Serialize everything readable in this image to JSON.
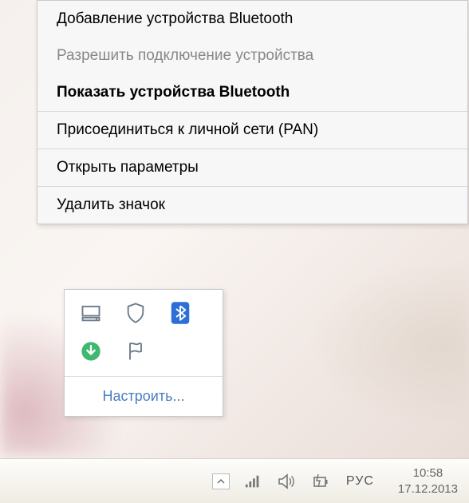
{
  "context_menu": {
    "items": [
      {
        "label": "Добавление устройства Bluetooth",
        "bold": false,
        "disabled": false
      },
      {
        "label": "Разрешить подключение устройства",
        "bold": false,
        "disabled": true
      },
      {
        "label": "Показать устройства Bluetooth",
        "bold": true,
        "disabled": false
      },
      {
        "type": "separator"
      },
      {
        "label": "Присоединиться к личной сети (PAN)",
        "bold": false,
        "disabled": false
      },
      {
        "type": "separator"
      },
      {
        "label": "Открыть параметры",
        "bold": false,
        "disabled": false
      },
      {
        "type": "separator"
      },
      {
        "label": "Удалить значок",
        "bold": false,
        "disabled": false
      }
    ]
  },
  "tray_popup": {
    "icons": [
      "drive-icon",
      "shield-icon",
      "bluetooth-icon",
      "download-icon",
      "flag-icon"
    ],
    "customize_label": "Настроить..."
  },
  "taskbar": {
    "chevron": "show-hidden-icons",
    "icons": [
      "signal-icon",
      "volume-icon",
      "power-icon"
    ],
    "language": "РУС",
    "time": "10:58",
    "date": "17.12.2013"
  },
  "colors": {
    "link": "#4a7dbf",
    "menu_bg": "#f7f7f7",
    "disabled": "#888888"
  }
}
